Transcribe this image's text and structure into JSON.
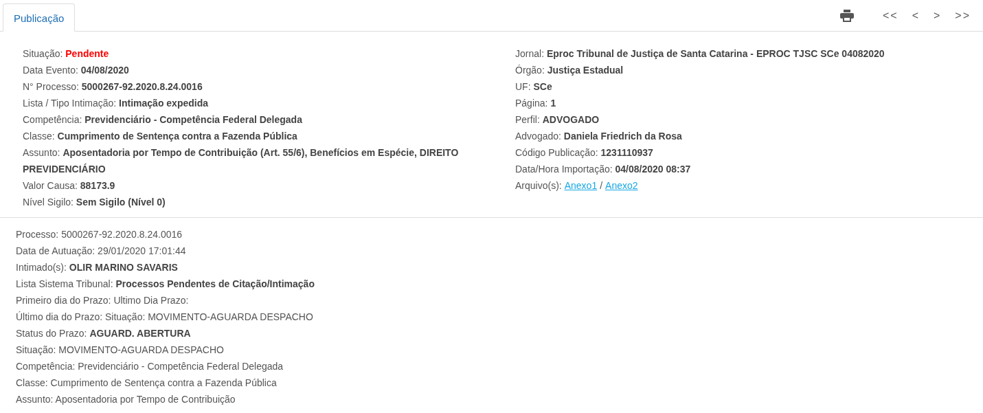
{
  "tabs": [
    {
      "label": "Publicação",
      "selected": true
    }
  ],
  "nav_buttons": [
    "<<",
    "<",
    ">",
    ">>"
  ],
  "left_fields": [
    {
      "label": "Situação:",
      "value": "Pendente",
      "kind": "alert"
    },
    {
      "label": "Data Evento:",
      "value": "04/08/2020",
      "kind": "text"
    },
    {
      "label": "N° Processo:",
      "value": "5000267-92.2020.8.24.0016",
      "kind": "text"
    },
    {
      "label": "Lista / Tipo Intimação:",
      "value": "Intimação expedida",
      "kind": "text"
    },
    {
      "label": "Competência:",
      "value": "Previdenciário - Competência Federal Delegada",
      "kind": "text"
    },
    {
      "label": "Classe:",
      "value": "Cumprimento de Sentença contra a Fazenda Pública",
      "kind": "text"
    },
    {
      "label": "Assunto:",
      "value": "Aposentadoria por Tempo de Contribuição (Art. 55/6), Benefícios em Espécie, DIREITO",
      "kind": "text"
    },
    {
      "value": "PREVIDENCIÁRIO",
      "kind": "continuation"
    },
    {
      "label": "Valor Causa:",
      "value": "88173.9",
      "kind": "text"
    },
    {
      "label": "Nível Sigilo:",
      "value": "Sem Sigilo (Nível 0)",
      "kind": "text"
    }
  ],
  "right_fields": [
    {
      "label": "Jornal:",
      "value": "Eproc Tribunal de Justiça de Santa Catarina - EPROC TJSC SCe 04082020"
    },
    {
      "label": "Órgão:",
      "value": "Justiça Estadual"
    },
    {
      "label": "UF:",
      "value": "SCe"
    },
    {
      "label": "Página:",
      "value": "1"
    },
    {
      "label": "Perfil:",
      "value": "ADVOGADO"
    },
    {
      "label": "Advogado:",
      "value": "Daniela Friedrich da Rosa"
    },
    {
      "label": "Código Publicação:",
      "value": "1231110937"
    },
    {
      "label": "Data/Hora Importação:",
      "value": "04/08/2020 08:37"
    }
  ],
  "attachments": {
    "label": "Arquivo(s):",
    "links": [
      "Anexo1",
      "Anexo2"
    ],
    "separator": "/"
  },
  "details": [
    "Processo: 5000267-92.2020.8.24.0016",
    "Data de Autuação: 29/01/2020 17:01:44",
    "Intimado(s): **OLIR MARINO SAVARIS**",
    "Lista Sistema Tribunal: **Processos Pendentes de Citação/Intimação**",
    "Primeiro dia do Prazo: Ultimo Dia Prazo:",
    "Último dia do Prazo: Situação: MOVIMENTO-AGUARDA DESPACHO",
    "Status do Prazo: **AGUARD. ABERTURA**",
    "Situação: MOVIMENTO-AGUARDA DESPACHO",
    "Competência: Previdenciário - Competência Federal Delegada",
    "Classe: Cumprimento de Sentença contra a Fazenda Pública",
    "Assunto: Aposentadoria por Tempo de Contribuição"
  ]
}
